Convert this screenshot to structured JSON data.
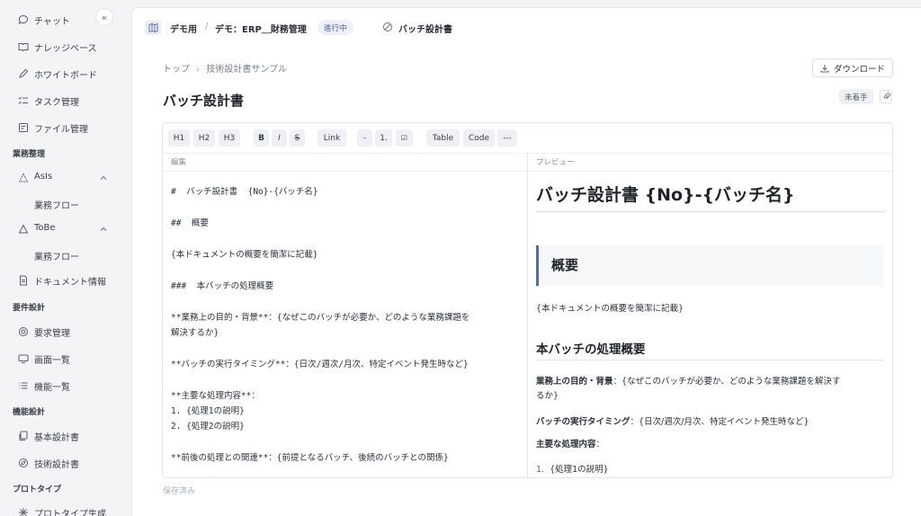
{
  "sidebar": {
    "collapse_label": "«",
    "items": [
      {
        "label": "チャット",
        "icon": "chat-bubble-icon"
      },
      {
        "label": "ナレッジベース",
        "icon": "book-icon"
      },
      {
        "label": "ホワイトボード",
        "icon": "pen-icon"
      },
      {
        "label": "タスク管理",
        "icon": "checklist-icon"
      },
      {
        "label": "ファイル管理",
        "icon": "folder-icon"
      }
    ],
    "section_business": "業務整理",
    "asis": {
      "label": "AsIs",
      "sub": "業務フロー"
    },
    "tobe": {
      "label": "ToBe",
      "sub": "業務フロー"
    },
    "doc_info": "ドキュメント情報",
    "section_requirements": "要件設計",
    "req_items": [
      {
        "label": "要求管理",
        "icon": "target-icon"
      },
      {
        "label": "画面一覧",
        "icon": "monitor-icon"
      },
      {
        "label": "機能一覧",
        "icon": "list-icon"
      }
    ],
    "section_function": "機能設計",
    "func_items": [
      {
        "label": "基本設計書",
        "icon": "copy-icon"
      },
      {
        "label": "技術設計書",
        "icon": "compass-icon"
      }
    ],
    "section_prototype": "プロトタイプ",
    "proto_item": "プロトタイプ生成"
  },
  "header": {
    "workspace": "デモ用",
    "project": "デモ：ERP＿財務管理",
    "status": "進行中",
    "document": "バッチ設計書"
  },
  "breadcrumb": {
    "home": "トップ",
    "parent": "技術設計書サンプル"
  },
  "download_label": "ダウンロード",
  "page_title": "バッチ設計書",
  "status_badge": "未着手",
  "toolbar": [
    "H1",
    "H2",
    "H3",
    "B",
    "I",
    "S",
    "Link",
    "-",
    "1.",
    "☑",
    "Table",
    "Code",
    "---"
  ],
  "editor": {
    "edit_label": "編集",
    "preview_label": "プレビュー",
    "source_lines": [
      "#  バッチ設計書  {No}-{バッチ名}",
      "",
      "##  概要",
      "",
      "{本ドキュメントの概要を簡潔に記載}",
      "",
      "###  本バッチの処理概要",
      "",
      "**業務上の目的・背景**：{なぜこのバッチが必要か、どのような業務課題を",
      "解決するか}",
      "",
      "**バッチの実行タイミング**：{日次/週次/月次、特定イベント発生時など}",
      "",
      "**主要な処理内容**：",
      "1. {処理1の説明}",
      "2. {処理2の説明}",
      "",
      "**前後の処理との関連**：{前提となるバッチ、後続のバッチとの関係}"
    ]
  },
  "preview": {
    "h1": "バッチ設計書 {No}-{バッチ名}",
    "h2": "概要",
    "summary": "{本ドキュメントの概要を簡潔に記載}",
    "h3": "本バッチの処理概要",
    "purpose_label": "業務上の目的・背景",
    "purpose_text": "：{なぜこのバッチが必要か、どのような業務課題を解決す",
    "purpose_cont": "るか}",
    "timing_label": "バッチの実行タイミング",
    "timing_text": "：{日次/週次/月次、特定イベント発生時など}",
    "main_label": "主要な処理内容",
    "main_colon": "：",
    "list_num": "1.",
    "list_item": "{処理1の説明}"
  },
  "saved_status": "保存済み"
}
